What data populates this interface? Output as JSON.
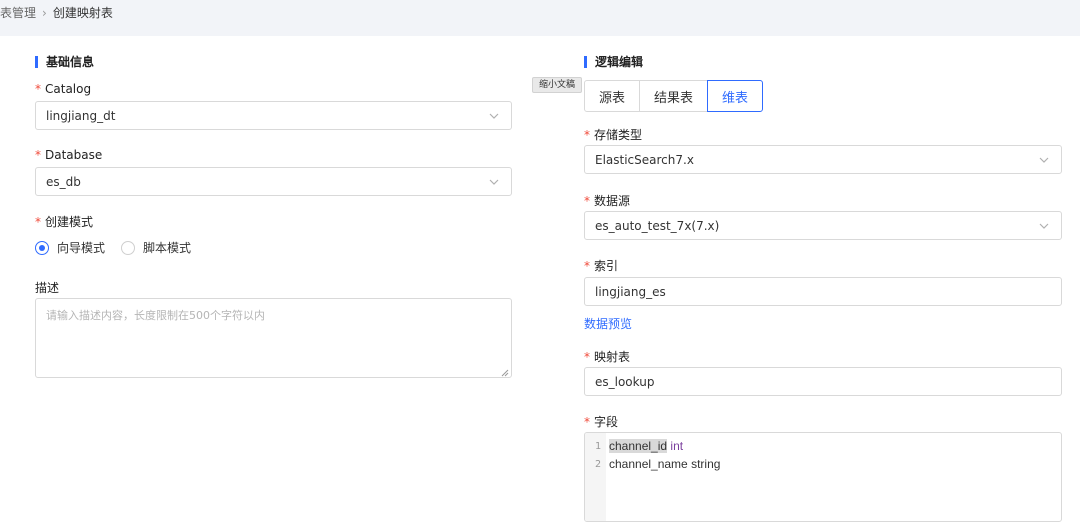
{
  "breadcrumb": {
    "prev": "表管理",
    "current": "创建映射表"
  },
  "left": {
    "section_title": "基础信息",
    "catalog": {
      "label": "Catalog",
      "value": "lingjiang_dt"
    },
    "database": {
      "label": "Database",
      "value": "es_db"
    },
    "mode": {
      "label": "创建模式",
      "options": [
        "向导模式",
        "脚本模式"
      ],
      "selected": "向导模式"
    },
    "description": {
      "label": "描述",
      "placeholder": "请输入描述内容，长度限制在500个字符以内"
    }
  },
  "tooltip": "缩小文稿",
  "right": {
    "section_title": "逻辑编辑",
    "tabs": [
      {
        "label": "源表"
      },
      {
        "label": "结果表"
      },
      {
        "label": "维表",
        "active": true
      }
    ],
    "storage_type": {
      "label": "存储类型",
      "value": "ElasticSearch7.x"
    },
    "data_source": {
      "label": "数据源",
      "value": "es_auto_test_7x(7.x)"
    },
    "index": {
      "label": "索引",
      "value": "lingjiang_es"
    },
    "preview_link": "数据预览",
    "mapping_table": {
      "label": "映射表",
      "value": "es_lookup"
    },
    "fields": {
      "label": "字段",
      "lines": [
        {
          "num": "1",
          "name": "channel_id",
          "type": "int"
        },
        {
          "num": "2",
          "name": "channel_name",
          "type": "string"
        }
      ]
    }
  },
  "colors": {
    "accent": "#2f6bff",
    "required": "#f04a3a",
    "keyword": "#7a3e9d",
    "topbar": "#f2f4f8"
  }
}
